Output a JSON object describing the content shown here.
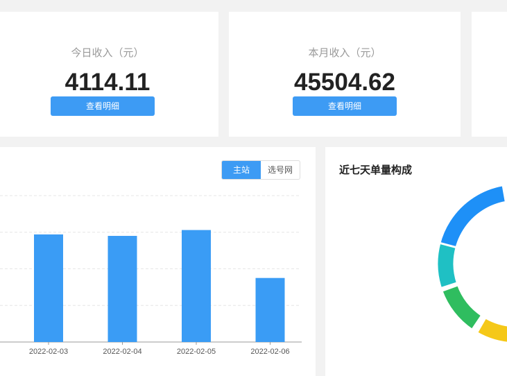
{
  "stats": [
    {
      "label": "今日收入（元）",
      "value": "4114.11",
      "button": "查看明细"
    },
    {
      "label": "本月收入（元）",
      "value": "45504.62",
      "button": "查看明细"
    }
  ],
  "bar_panel": {
    "tabs": [
      {
        "label": "主站",
        "active": true
      },
      {
        "label": "选号网",
        "active": false
      }
    ]
  },
  "donut_panel": {
    "title": "近七天单量构成"
  },
  "colors": {
    "accent": "#3d9bf4",
    "bar": "#3a9cf5"
  },
  "chart_data": [
    {
      "type": "bar",
      "categories": [
        "2022-02-03",
        "2022-02-04",
        "2022-02-05",
        "2022-02-06"
      ],
      "values": [
        294,
        290,
        306,
        175
      ],
      "ylim": [
        0,
        400
      ],
      "grid": true,
      "title": "",
      "xlabel": "",
      "ylabel": ""
    },
    {
      "type": "pie",
      "title": "近七天单量构成",
      "segments": [
        {
          "color": "#1e90f7",
          "start": 165,
          "end": 260
        },
        {
          "color": "#1fc0c4",
          "start": -198,
          "end": -165
        },
        {
          "color": "#2fbd5f",
          "start": -236,
          "end": -200
        },
        {
          "color": "#f5c818",
          "start": -298,
          "end": -240
        }
      ]
    }
  ]
}
